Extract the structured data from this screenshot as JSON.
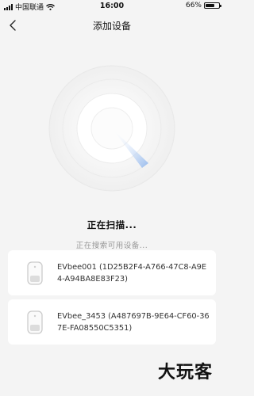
{
  "status_bar": {
    "carrier": "中国联通",
    "time": "16:00",
    "battery_text": "66%",
    "battery_level": 0.66
  },
  "nav": {
    "title": "添加设备",
    "back_icon": "chevron-left-icon"
  },
  "scan": {
    "title": "正在扫描...",
    "subtitle": "正在搜索可用设备..."
  },
  "devices": [
    {
      "name": "EVbee001 (1D25B2F4-A766-47C8-A9E4-A94BA8E83F23)",
      "icon": "charger-icon"
    },
    {
      "name": "EVbee_3453 (A487697B-9E64-CF60-367E-FA08550C5351)",
      "icon": "charger-icon"
    }
  ],
  "watermark": "大玩客",
  "colors": {
    "background": "#f4f4f4",
    "card": "#ffffff",
    "radar_sweep": "#8fb6ee"
  }
}
